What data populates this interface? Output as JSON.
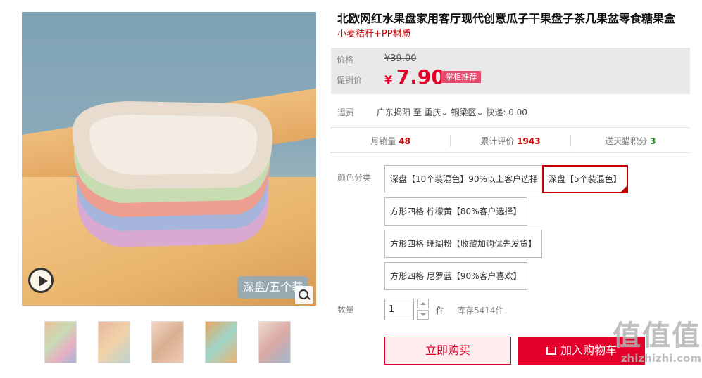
{
  "product": {
    "title": "北欧网红水果盘家用客厅现代创意瓜子干果盘子茶几果盆零食糖果盒",
    "subtitle": "小麦秸秆+PP材质"
  },
  "gallery": {
    "main_badge": "深盘/五个装",
    "play_icon": "play-icon",
    "zoom_icon": "zoom-icon",
    "thumbnail_count": 5
  },
  "price": {
    "orig_label": "价格",
    "orig_value": "¥39.00",
    "promo_label": "促销价",
    "currency": "¥",
    "promo_value": "7.90",
    "promo_tag": "掌柜推荐"
  },
  "shipping": {
    "label": "运费",
    "from": "广东揭阳",
    "to_prefix": "至",
    "province": "重庆",
    "district": "铜梁区",
    "express": "快递: 0.00"
  },
  "stats": {
    "sales_label": "月销量",
    "sales_value": "48",
    "reviews_label": "累计评价",
    "reviews_value": "1943",
    "points_label": "送天猫积分",
    "points_value": "3"
  },
  "sku": {
    "label": "颜色分类",
    "options": [
      "深盘【10个装混色】90%以上客户选择",
      "深盘【5个装混色】",
      "方形四格 柠檬黄【80%客户选择】",
      "方形四格 珊瑚粉【收藏加购优先发货】",
      "方形四格 尼罗蓝【90%客户喜欢】"
    ],
    "selected_index": 1
  },
  "quantity": {
    "label": "数量",
    "value": "1",
    "unit": "件",
    "stock": "库存5414件"
  },
  "actions": {
    "buy_now": "立即购买",
    "add_cart": "加入购物车"
  },
  "watermark": {
    "big": "值值值",
    "small": "zhizhizhi.com"
  },
  "colors": {
    "accent": "#e4002b",
    "price_red": "#c40000",
    "promo_pink": "#e54a6f"
  }
}
